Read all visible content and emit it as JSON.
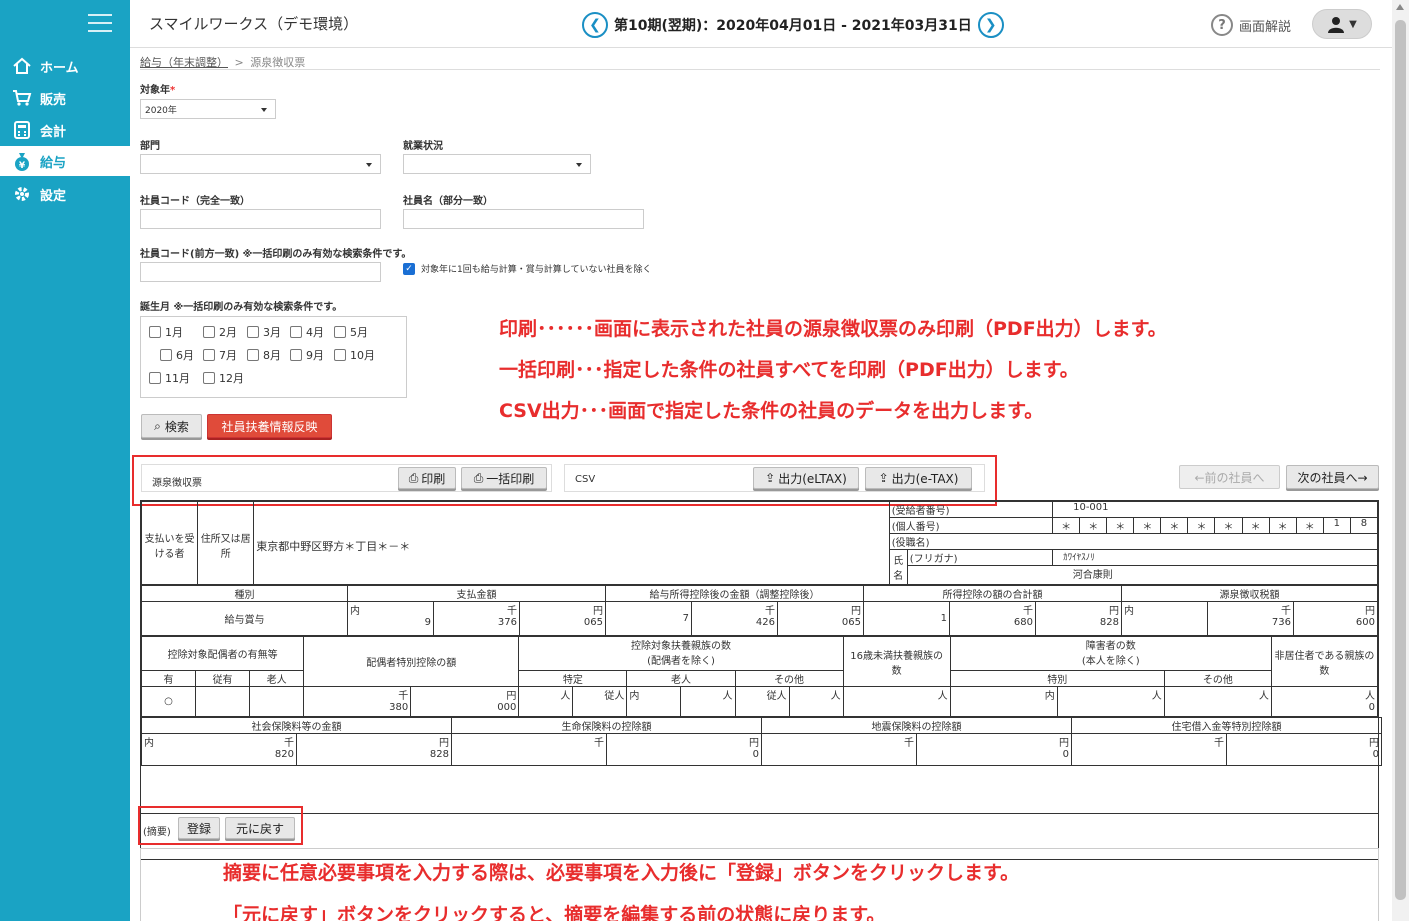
{
  "sidebar": {
    "items": [
      {
        "label": "ホーム",
        "icon": "home-icon"
      },
      {
        "label": "販売",
        "icon": "cart-icon"
      },
      {
        "label": "会計",
        "icon": "calculator-icon"
      },
      {
        "label": "給与",
        "icon": "money-bag-icon"
      },
      {
        "label": "設定",
        "icon": "gear-icon"
      }
    ]
  },
  "header": {
    "app_title": "スマイルワークス（デモ環境）",
    "period": "第10期(翌期)：2020年04月01日 - 2021年03月31日",
    "help_label": "画面解説"
  },
  "breadcrumb": {
    "parent": "給与（年末調整）",
    "sep": ">",
    "current": "源泉徴収票"
  },
  "filters": {
    "year_label": "対象年",
    "year_required": "*",
    "year_value": "2020年",
    "dept_label": "部門",
    "employment_label": "就業状況",
    "code_exact_label": "社員コード（完全一致）",
    "name_partial_label": "社員名（部分一致）",
    "code_prefix_label": "社員コード(前方一致) ※一括印刷のみ有効な検索条件です。",
    "exclude_label": "対象年に1回も給与計算・賞与計算していない社員を除く",
    "birth_month_label": "誕生月 ※一括印刷のみ有効な検索条件です。",
    "months": [
      "1月",
      "2月",
      "3月",
      "4月",
      "5月",
      "6月",
      "7月",
      "8月",
      "9月",
      "10月",
      "11月",
      "12月"
    ],
    "search_button": "検索",
    "reflect_button": "社員扶養情報反映"
  },
  "notes": [
    "印刷･･････画面に表示された社員の源泉徴収票のみ印刷（PDF出力）します。",
    "一括印刷･･･指定した条件の社員すべてを印刷（PDF出力）します。",
    "CSV出力･･･画面で指定した条件の社員のデータを出力します。"
  ],
  "toolbar": {
    "group1_label": "源泉徴収票",
    "print_button": "印刷",
    "bulk_print_button": "一括印刷",
    "group2_label": "CSV",
    "eltax_button": "出力(eLTAX)",
    "etax_button": "出力(e-TAX)",
    "prev_button": "←前の社員へ",
    "next_button": "次の社員へ→"
  },
  "form": {
    "payee_label": "支払いを受ける者",
    "address_label": "住所又は居所",
    "address": "東京都中野区野方＊丁目＊－＊",
    "recipient_no_label": "(受給者番号)",
    "recipient_no": "10-001",
    "individual_no_label": "(個人番号)",
    "individual_no_digits": [
      "＊",
      "＊",
      "＊",
      "＊",
      "＊",
      "＊",
      "＊",
      "＊",
      "＊",
      "＊",
      "1",
      "8"
    ],
    "position_label": "(役職名)",
    "name_label": "氏名",
    "furigana_label": "(フリガナ)",
    "furigana": "ｶﾜｲﾔｽﾉﾘ",
    "name": "河合康則",
    "h_type": "種別",
    "h_payment": "支払金額",
    "h_after_deduction": "給与所得控除後の金額（調整控除後）",
    "h_total_deduction": "所得控除の額の合計額",
    "h_withholding": "源泉徴収税額",
    "type_value": "給与賞与",
    "u_uchi": "内",
    "u_sen": "千",
    "u_en": "円",
    "pay_a": "9",
    "pay_b": "376",
    "pay_c": "065",
    "after_a": "7",
    "after_b": "426",
    "after_c": "065",
    "ded_a": "1",
    "ded_b": "680",
    "ded_c": "828",
    "wh_b": "736",
    "wh_c": "600",
    "h_spouse_exist": "控除対象配偶者の有無等",
    "h_spouse_special": "配偶者特別控除の額",
    "h_dependents": "控除対象扶養親族の数\n(配偶者を除く)",
    "h_under16": "16歳未満扶養親族の数",
    "h_disabled": "障害者の数\n(本人を除く)",
    "h_nonresident": "非居住者である親族の数",
    "s_yes": "有",
    "s_jyu": "従有",
    "s_old": "老人",
    "d_tokutei": "特定",
    "d_rojin": "老人",
    "d_other": "その他",
    "dis_special": "特別",
    "dis_other": "その他",
    "u_nin": "人",
    "u_jyu": "従人",
    "spouse_mark": "○",
    "sp_sen": "380",
    "sp_en": "000",
    "nonres_value": "0",
    "h_social": "社会保険料等の金額",
    "h_life": "生命保険料の控除額",
    "h_quake": "地震保険料の控除額",
    "h_housing": "住宅借入金等特別控除額",
    "soc_sen": "820",
    "soc_en": "828",
    "life_en": "0",
    "quake_en": "0",
    "housing_en": "0"
  },
  "remarks": {
    "label": "(摘要)",
    "register_button": "登録",
    "revert_button": "元に戻す",
    "note1": "摘要に任意必要事項を入力する際は、必要事項を入力後に「登録」ボタンをクリックします。",
    "note2": "「元に戻す」ボタンをクリックすると、摘要を編集する前の状態に戻ります。"
  }
}
